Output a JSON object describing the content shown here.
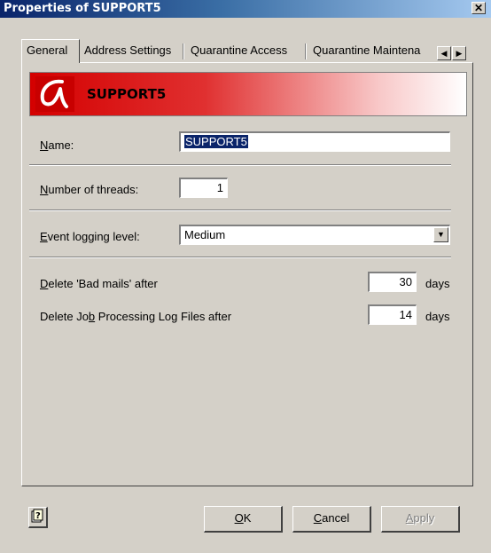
{
  "window": {
    "title": "Properties of SUPPORT5",
    "close_glyph": "✕"
  },
  "tabs": [
    {
      "label": "General",
      "active": true
    },
    {
      "label": "Address Settings",
      "active": false
    },
    {
      "label": "Quarantine Access",
      "active": false
    },
    {
      "label": "Quarantine Maintena",
      "active": false
    }
  ],
  "tab_scroll": {
    "left": "◀",
    "right": "▶"
  },
  "banner": {
    "name": "SUPPORT5",
    "logo_icon": "avira-logo",
    "color": "#d40000"
  },
  "form": {
    "name_label_u": "N",
    "name_label_rest": "ame:",
    "name_value": "SUPPORT5",
    "threads_label_u": "N",
    "threads_label_rest": "umber of threads:",
    "threads_value": "1",
    "logging_label_u": "E",
    "logging_label_rest": "vent logging level:",
    "logging_value": "Medium",
    "badmails_label_u": "D",
    "badmails_label_rest": "elete 'Bad mails' after",
    "badmails_value": "30",
    "badmails_unit": "days",
    "joblog_label_pre": "Delete Jo",
    "joblog_label_u": "b",
    "joblog_label_rest": " Processing Log Files after",
    "joblog_value": "14",
    "joblog_unit": "days"
  },
  "buttons": {
    "ok_u": "O",
    "ok_rest": "K",
    "cancel_u": "C",
    "cancel_rest": "ancel",
    "apply_u": "A",
    "apply_rest": "pply"
  }
}
